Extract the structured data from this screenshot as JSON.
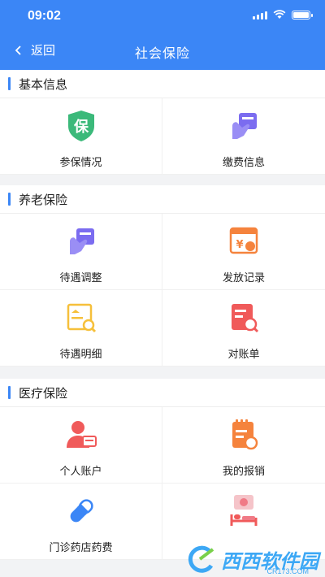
{
  "status_bar": {
    "time": "09:02"
  },
  "nav": {
    "back_label": "返回",
    "title": "社会保险"
  },
  "sections": [
    {
      "title": "基本信息",
      "items": [
        {
          "label": "参保情况",
          "icon": "shield-icon"
        },
        {
          "label": "缴费信息",
          "icon": "card-icon"
        }
      ]
    },
    {
      "title": "养老保险",
      "items": [
        {
          "label": "待遇调整",
          "icon": "card-icon"
        },
        {
          "label": "发放记录",
          "icon": "payment-record-icon"
        },
        {
          "label": "待遇明细",
          "icon": "detail-search-icon"
        },
        {
          "label": "对账单",
          "icon": "statement-icon"
        }
      ]
    },
    {
      "title": "医疗保险",
      "items": [
        {
          "label": "个人账户",
          "icon": "personal-account-icon"
        },
        {
          "label": "我的报销",
          "icon": "reimbursement-icon"
        },
        {
          "label": "门诊药店药费",
          "icon": "pill-icon"
        },
        {
          "label": "",
          "icon": "hospital-bed-icon"
        }
      ]
    }
  ],
  "icon_texts": {
    "shield": "保",
    "yuan": "¥"
  },
  "watermark": {
    "text": "西西软件园",
    "sub": "CR173.COM"
  },
  "colors": {
    "primary": "#3b86f6",
    "green": "#3bb97a",
    "purple": "#7b6cf0",
    "orange": "#f5833d",
    "yellow": "#f6c03b",
    "red": "#f05a5a"
  }
}
